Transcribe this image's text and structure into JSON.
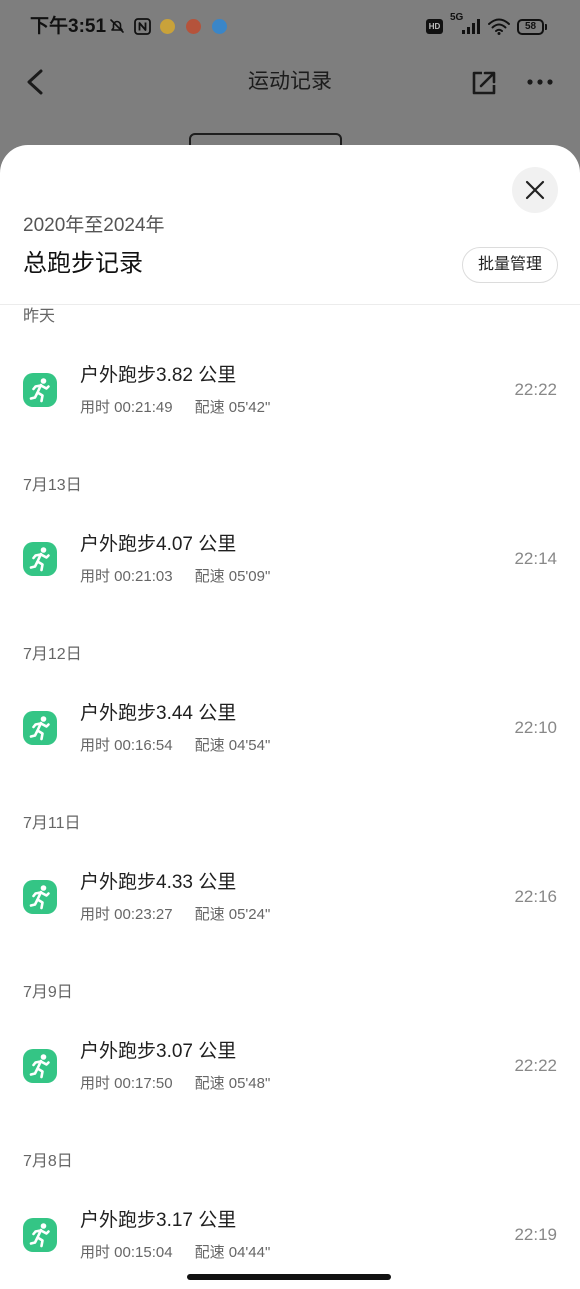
{
  "status_bar": {
    "time": "下午3:51",
    "hd_label": "HD",
    "network_label": "5G",
    "battery_level": "58",
    "icons": [
      "do-not-disturb-icon",
      "nfc-icon",
      "app-notification-icon",
      "app-notification-icon",
      "app-notification-icon",
      "signal-icon",
      "wifi-icon",
      "battery-icon"
    ]
  },
  "header": {
    "title": "运动记录",
    "icons": {
      "back": "back-arrow-icon",
      "share": "share-icon",
      "more": "more-icon"
    }
  },
  "sheet": {
    "date_range": "2020年至2024年",
    "title": "总跑步记录",
    "batch_manage_button": "批量管理",
    "close_icon": "close-icon"
  },
  "records": [
    {
      "date": "昨天",
      "title": "户外跑步3.82 公里",
      "duration": "用时 00:21:49",
      "pace": "配速 05'42\"",
      "end_time": "22:22",
      "icon": "running-icon"
    },
    {
      "date": "7月13日",
      "title": "户外跑步4.07 公里",
      "duration": "用时 00:21:03",
      "pace": "配速 05'09\"",
      "end_time": "22:14",
      "icon": "running-icon"
    },
    {
      "date": "7月12日",
      "title": "户外跑步3.44 公里",
      "duration": "用时 00:16:54",
      "pace": "配速 04'54\"",
      "end_time": "22:10",
      "icon": "running-icon"
    },
    {
      "date": "7月11日",
      "title": "户外跑步4.33 公里",
      "duration": "用时 00:23:27",
      "pace": "配速 05'24\"",
      "end_time": "22:16",
      "icon": "running-icon"
    },
    {
      "date": "7月9日",
      "title": "户外跑步3.07 公里",
      "duration": "用时 00:17:50",
      "pace": "配速 05'48\"",
      "end_time": "22:22",
      "icon": "running-icon"
    },
    {
      "date": "7月8日",
      "title": "户外跑步3.17 公里",
      "duration": "用时 00:15:04",
      "pace": "配速 04'44\"",
      "end_time": "22:19",
      "icon": "running-icon"
    }
  ],
  "colors": {
    "accent_green": "#34c585",
    "overlay_gray": "#7e7e7e",
    "sheet_background": "#ffffff",
    "primary_text": "#1f1f1f",
    "secondary_text": "#666666",
    "time_text": "#888888"
  }
}
